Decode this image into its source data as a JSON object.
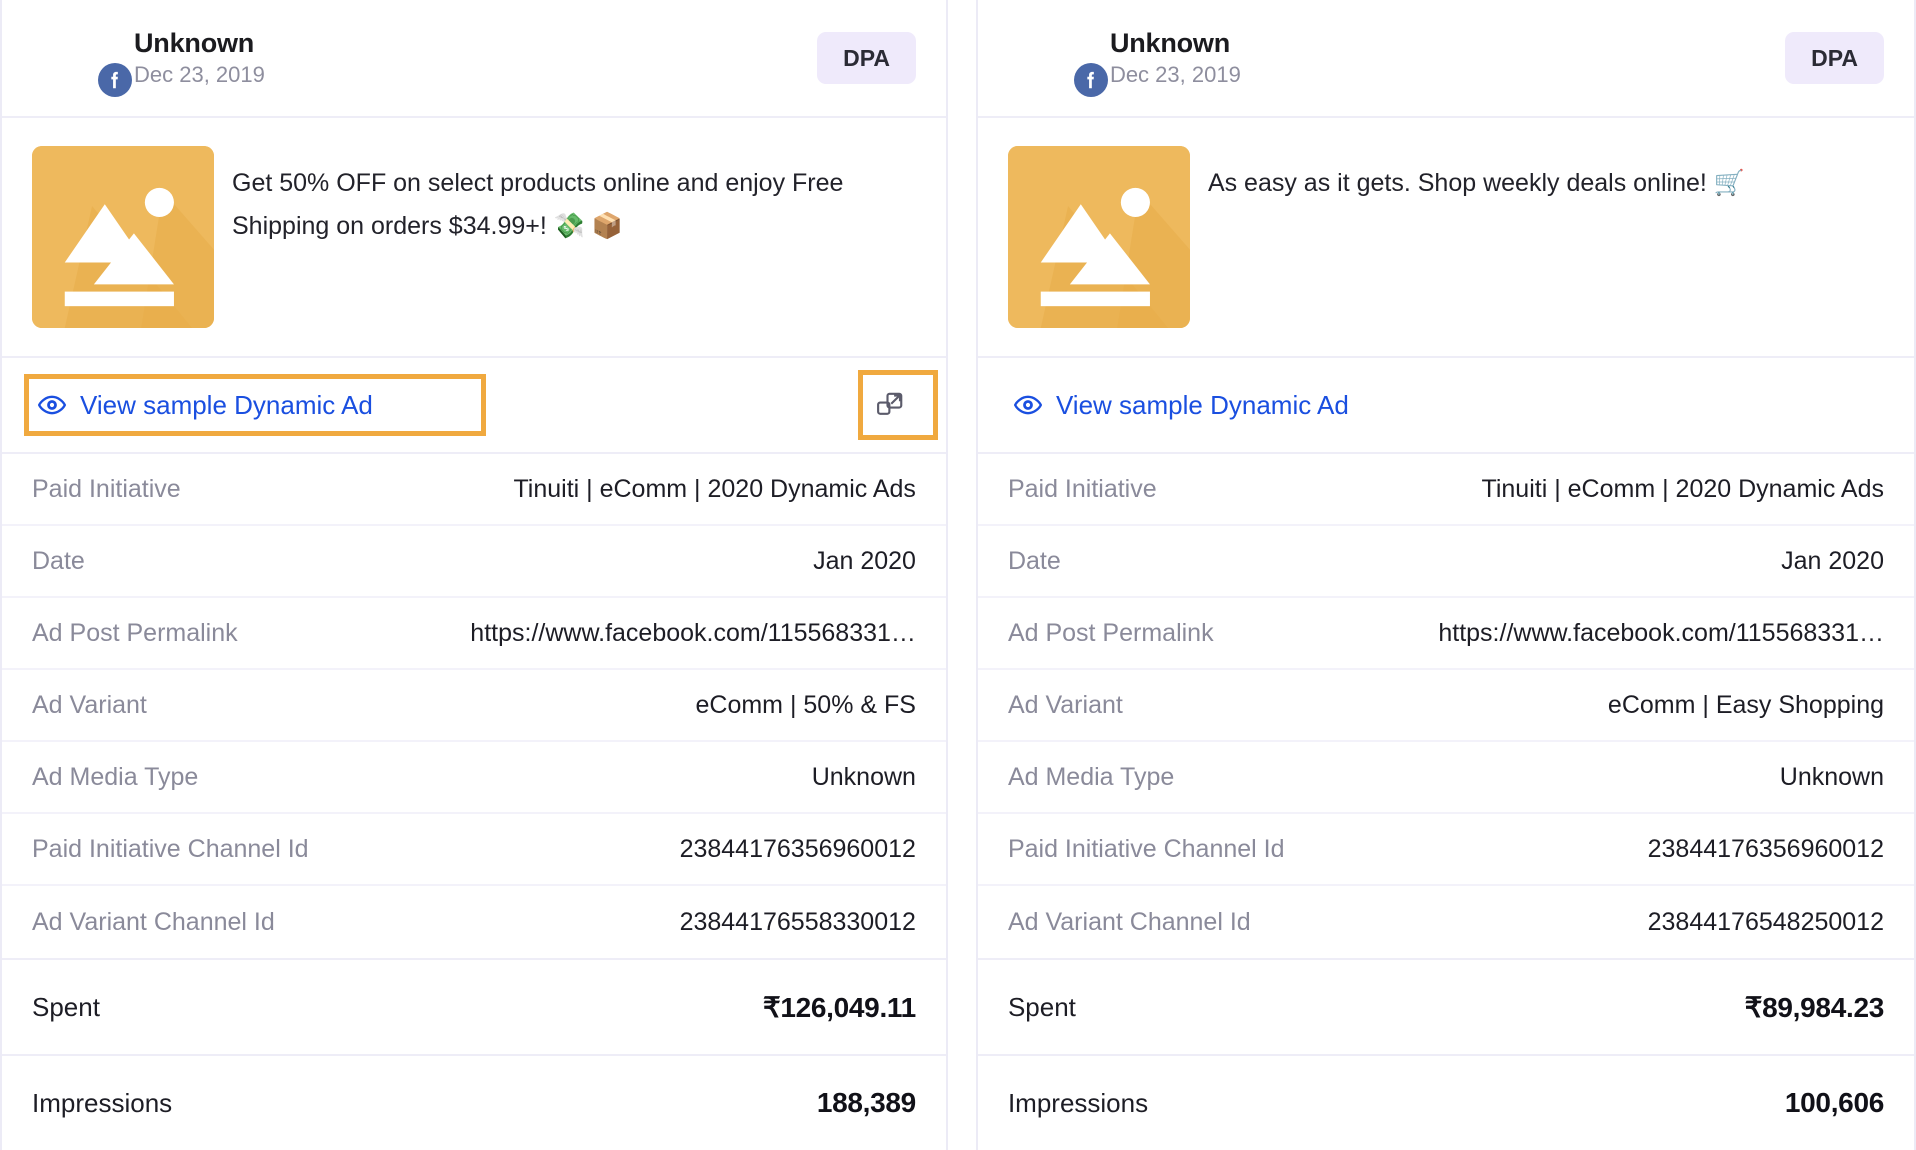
{
  "colors": {
    "link_blue": "#1a4fe0",
    "annotation_orange": "#f0a93f",
    "badge_bg": "#efeafb",
    "facebook_blue": "#4a68a8",
    "thumb_amber": "#eeb95d",
    "divider": "#eeedf7"
  },
  "detail_labels": {
    "paid_initiative": "Paid Initiative",
    "date": "Date",
    "permalink": "Ad Post Permalink",
    "ad_variant": "Ad Variant",
    "ad_media_type": "Ad Media Type",
    "paid_initiative_channel_id": "Paid Initiative Channel Id",
    "ad_variant_channel_id": "Ad Variant Channel Id"
  },
  "metric_labels": {
    "spent": "Spent",
    "impressions": "Impressions"
  },
  "link_label": "View sample Dynamic Ad",
  "cards": [
    {
      "advertiser": "Unknown",
      "date": "Dec 23, 2019",
      "badge": "DPA",
      "creative_text": "Get 50% OFF on select products online and enjoy Free Shipping on orders $34.99+! 💸 📦",
      "details": {
        "paid_initiative": "Tinuiti | eComm | 2020 Dynamic Ads",
        "date": "Jan 2020",
        "permalink": "https://www.facebook.com/115568331…",
        "ad_variant": "eComm | 50% & FS",
        "ad_media_type": "Unknown",
        "paid_initiative_channel_id": "23844176356960012",
        "ad_variant_channel_id": "23844176558330012"
      },
      "metrics": {
        "spent": "₹126,049.11",
        "impressions": "188,389"
      }
    },
    {
      "advertiser": "Unknown",
      "date": "Dec 23, 2019",
      "badge": "DPA",
      "creative_text": "As easy as it gets. Shop weekly deals online! 🛒",
      "details": {
        "paid_initiative": "Tinuiti | eComm | 2020 Dynamic Ads",
        "date": "Jan 2020",
        "permalink": "https://www.facebook.com/115568331…",
        "ad_variant": "eComm | Easy Shopping",
        "ad_media_type": "Unknown",
        "paid_initiative_channel_id": "23844176356960012",
        "ad_variant_channel_id": "23844176548250012"
      },
      "metrics": {
        "spent": "₹89,984.23",
        "impressions": "100,606"
      }
    }
  ]
}
